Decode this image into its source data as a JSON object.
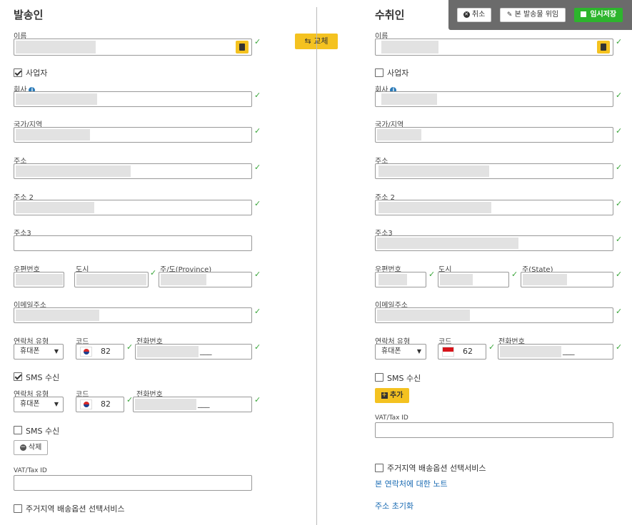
{
  "header": {
    "cancel": "취소",
    "delegate": "본 발송물 위임",
    "save": "임시저장"
  },
  "swap_label": "교체",
  "sender": {
    "title": "발송인",
    "name_label": "이름",
    "business_label": "사업자",
    "business_checked": true,
    "company_label": "회사",
    "country_label": "국가/지역",
    "address_label": "주소",
    "address2_label": "주소 2",
    "address3_label": "주소3",
    "postal_label": "우편번호",
    "city_label": "도시",
    "province_label": "주/도(Province)",
    "email_label": "이메일주소",
    "contact_type_label": "연락처 유형",
    "code_label": "코드",
    "phone_label": "전화번호",
    "contact_type_value": "휴대폰",
    "code_value": "82",
    "sms_label": "SMS 수신",
    "sms1_checked": true,
    "contact2_type_label": "연락처 유형",
    "code2_label": "코드",
    "phone2_label": "전화번호",
    "contact2_type_value": "휴대폰",
    "code2_value": "82",
    "sms2_label": "SMS 수신",
    "delete_label": "삭제",
    "vat_label": "VAT/Tax ID",
    "residential_label": "주거지역 배송옵션 선택서비스"
  },
  "recipient": {
    "title": "수취인",
    "name_label": "이름",
    "business_label": "사업자",
    "company_label": "회사",
    "country_label": "국가/지역",
    "address_label": "주소",
    "address2_label": "주소 2",
    "address3_label": "주소3",
    "postal_label": "우편번호",
    "city_label": "도시",
    "state_label": "주(State)",
    "email_label": "이메일주소",
    "contact_type_label": "연락처 유형",
    "code_label": "코드",
    "phone_label": "전화번호",
    "contact_type_value": "휴대폰",
    "code_value": "62",
    "sms_label": "SMS 수신",
    "add_label": "추가",
    "vat_label": "VAT/Tax ID",
    "residential_label": "주거지역 배송옵션 선택서비스",
    "note_link": "본 연락처에 대한 노트",
    "reset_link": "주소 초기화"
  },
  "phone_mask": "___",
  "colors": {
    "accent": "#f4c220",
    "save_green": "#2db52d",
    "check_green": "#3aa53a",
    "link": "#1a6bb3"
  }
}
